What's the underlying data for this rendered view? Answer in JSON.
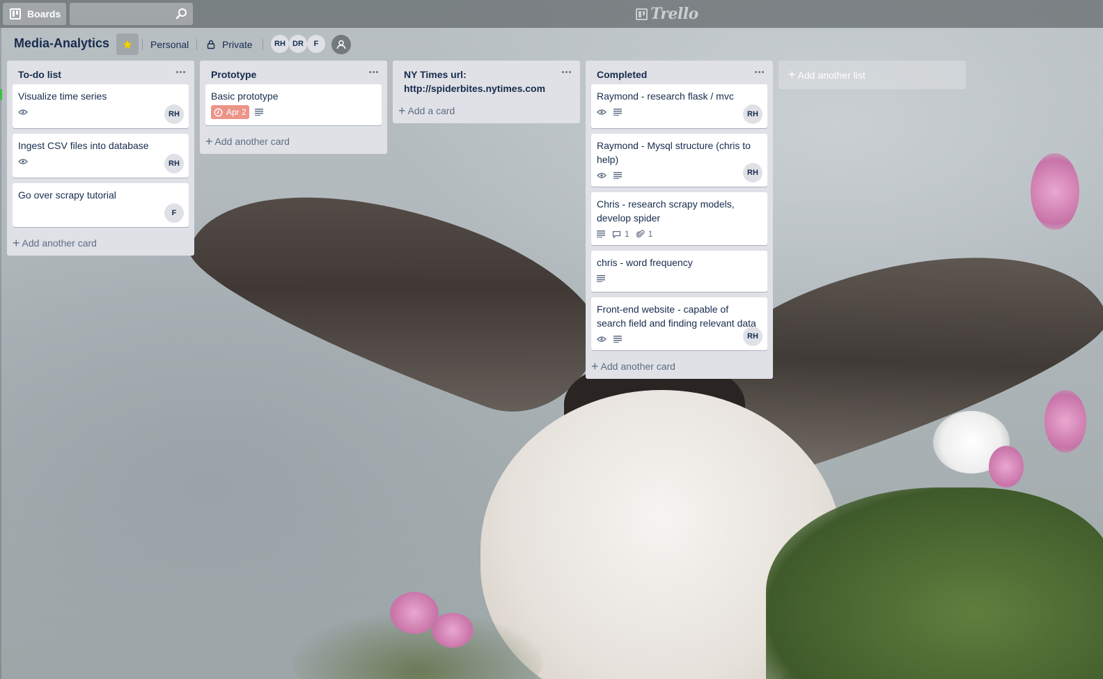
{
  "header": {
    "boards_label": "Boards",
    "search_value": "",
    "logo_text": "Trello"
  },
  "board": {
    "title": "Media-Analytics",
    "starred": true,
    "team_label": "Personal",
    "visibility_label": "Private",
    "members": [
      "RH",
      "DR",
      "F"
    ],
    "star_color": "#f2d600"
  },
  "lists": [
    {
      "title": "To-do list",
      "cards": [
        {
          "title": "Visualize time series",
          "member": "RH"
        },
        {
          "title": "Ingest CSV files into database",
          "member": "RH"
        },
        {
          "title": "Go over scrapy tutorial",
          "member": "F"
        }
      ],
      "add_label": "Add another card"
    },
    {
      "title": "Prototype",
      "cards": [
        {
          "title": "Basic prototype",
          "due": "Apr 2"
        }
      ],
      "add_label": "Add another card"
    },
    {
      "title": "NY Times url: http://spiderbites.nytimes.com",
      "cards": [],
      "add_label": "Add a card"
    },
    {
      "title": "Completed",
      "cards": [
        {
          "title": "Raymond - research flask / mvc",
          "member": "RH"
        },
        {
          "title": "Raymond - Mysql structure (chris to help)",
          "member": "RH"
        },
        {
          "title": "Chris - research scrapy models, develop spider",
          "comments": "1",
          "attachments": "1"
        },
        {
          "title": "chris - word frequency"
        },
        {
          "title": "Front-end website - capable of search field and finding relevant data",
          "member": "RH"
        }
      ],
      "add_label": "Add another card"
    }
  ],
  "add_list_label": "Add another list",
  "colors": {
    "due_badge": "#ec9488",
    "list_bg": "#dfe1e6"
  }
}
